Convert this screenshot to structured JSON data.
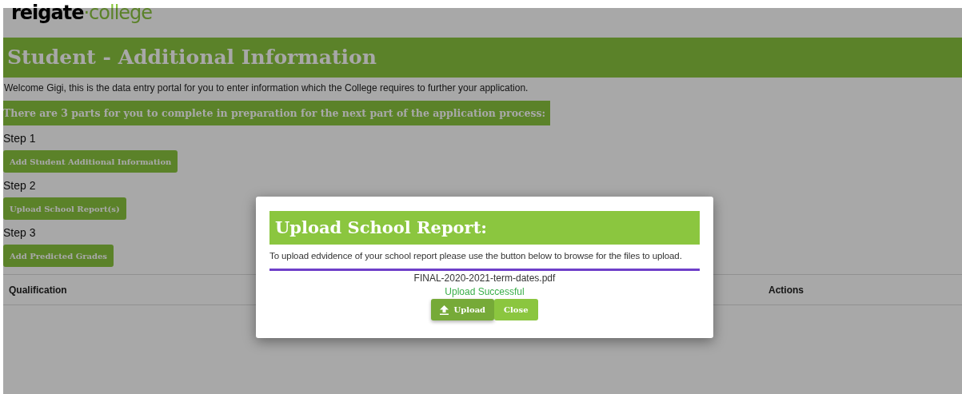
{
  "logo": {
    "part_1": "reigate",
    "part_2": "·college"
  },
  "page_title": "Student - Additional Information",
  "welcome": "Welcome Gigi, this is the data entry portal for you to enter information which the College requires to further your application.",
  "parts_banner": "There are 3 parts for you to complete in preparation for the next part of the application process:",
  "steps": [
    {
      "label": "Step 1",
      "button": "Add Student Additional Information"
    },
    {
      "label": "Step 2",
      "button": "Upload School Report(s)"
    },
    {
      "label": "Step 3",
      "button": "Add Predicted Grades"
    }
  ],
  "table": {
    "columns": [
      "Qualification",
      "Actions"
    ]
  },
  "modal": {
    "title": "Upload School Report:",
    "instructions": "To upload edvidence of your school report please use the button below to browse for the files to upload.",
    "file_name": "FINAL-2020-2021-term-dates.pdf",
    "status": "Upload Successful",
    "upload_button": "Upload",
    "close_button": "Close"
  }
}
